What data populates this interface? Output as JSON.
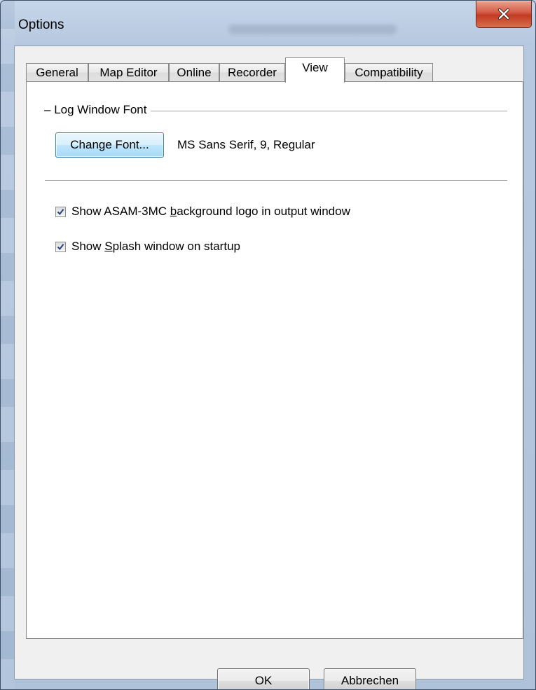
{
  "window": {
    "title": "Options",
    "close_icon": "close-x-icon"
  },
  "tabs": [
    {
      "label": "General"
    },
    {
      "label": "Map Editor"
    },
    {
      "label": "Online"
    },
    {
      "label": "Recorder"
    },
    {
      "label": "View",
      "active": true
    },
    {
      "label": "Compatibility"
    }
  ],
  "view_page": {
    "group_title": "Log Window Font",
    "change_font_label": "Change Font...",
    "font_description": "MS Sans Serif, 9, Regular",
    "options": [
      {
        "before": "Show ASAM-3MC ",
        "accel": "b",
        "after": "ackground logo in output window",
        "checked": true
      },
      {
        "before": "Show ",
        "accel": "S",
        "after": "plash window on startup",
        "checked": true
      }
    ]
  },
  "buttons": {
    "ok": "OK",
    "cancel": "Abbrechen"
  }
}
